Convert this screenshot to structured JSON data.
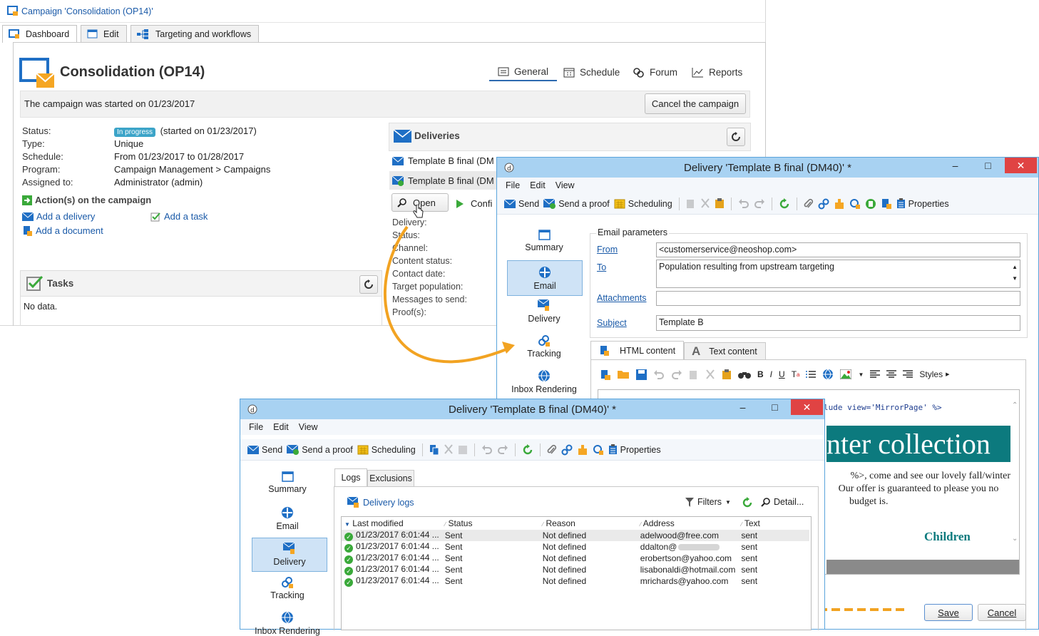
{
  "campaign": {
    "window_title": "Campaign 'Consolidation (OP14)'",
    "tabs": [
      {
        "label": "Dashboard"
      },
      {
        "label": "Edit"
      },
      {
        "label": "Targeting and workflows"
      }
    ],
    "heading": "Consolidation (OP14)",
    "nav": [
      {
        "label": "General"
      },
      {
        "label": "Schedule"
      },
      {
        "label": "Forum"
      },
      {
        "label": "Reports"
      }
    ],
    "started_message": "The campaign was started on 01/23/2017",
    "cancel_label": "Cancel the campaign",
    "info": {
      "status_label": "Status:",
      "status_badge": "In progress",
      "status_value": "(started on 01/23/2017)",
      "type_label": "Type:",
      "type_value": "Unique",
      "schedule_label": "Schedule:",
      "schedule_value": "From 01/23/2017 to 01/28/2017",
      "program_label": "Program:",
      "program_value": "Campaign Management > Campaigns",
      "assigned_label": "Assigned to:",
      "assigned_value": "Administrator (admin)"
    },
    "actions_title": "Action(s) on the campaign",
    "add_delivery": "Add a delivery",
    "add_task": "Add a task",
    "add_document": "Add a document",
    "tasks_title": "Tasks",
    "tasks_empty": "No data.",
    "deliveries": {
      "title": "Deliveries",
      "items": [
        "Template B final (DM",
        "Template B final (DM"
      ],
      "open_label": "Open",
      "confirm_label": "Confi",
      "fields": [
        "Delivery:",
        "Status:",
        "Channel:",
        "Content status:",
        "Contact date:",
        "Target population:",
        "Messages to send:",
        "Proof(s):"
      ]
    }
  },
  "delivery_back": {
    "title": "Delivery 'Template B final (DM40)' *",
    "menu": [
      "File",
      "Edit",
      "View"
    ],
    "toolbar": {
      "send": "Send",
      "proof": "Send a proof",
      "scheduling": "Scheduling",
      "properties": "Properties"
    },
    "side": [
      "Summary",
      "Email",
      "Delivery",
      "Tracking",
      "Inbox Rendering"
    ],
    "email_params": "Email parameters",
    "from_label": "From",
    "from_value": "<customerservice@neoshop.com>",
    "to_label": "To",
    "to_value": "Population resulting from upstream targeting",
    "attachments_label": "Attachments",
    "attachments_value": "",
    "subject_label": "Subject",
    "subject_value": "Template B",
    "content_tabs": [
      "HTML content",
      "Text content"
    ],
    "styles_label": "Styles",
    "editor": {
      "code": "lude view='MirrorPage' %>",
      "banner": "nter collection",
      "line1": "%>, come and see our lovely fall/winter",
      "line2": "Our offer is guaranteed to please you no",
      "line3": "budget is.",
      "children": "Children"
    },
    "save_label": "Save",
    "cancel_label": "Cancel"
  },
  "delivery_front": {
    "title": "Delivery 'Template B final (DM40)' *",
    "menu": [
      "File",
      "Edit",
      "View"
    ],
    "toolbar": {
      "send": "Send",
      "proof": "Send a proof",
      "scheduling": "Scheduling",
      "properties": "Properties"
    },
    "side": [
      "Summary",
      "Email",
      "Delivery",
      "Tracking",
      "Inbox Rendering"
    ],
    "tabs": [
      "Logs",
      "Exclusions"
    ],
    "logs_title": "Delivery logs",
    "filters_label": "Filters",
    "detail_label": "Detail...",
    "columns": [
      "Last modified",
      "Status",
      "Reason",
      "Address",
      "Text"
    ],
    "rows": [
      {
        "date": "01/23/2017 6:01:44 ...",
        "status": "Sent",
        "reason": "Not defined",
        "address": "adelwood@free.com",
        "text": "sent"
      },
      {
        "date": "01/23/2017 6:01:44 ...",
        "status": "Sent",
        "reason": "Not defined",
        "address": "ddalton@",
        "text": "sent"
      },
      {
        "date": "01/23/2017 6:01:44 ...",
        "status": "Sent",
        "reason": "Not defined",
        "address": "erobertson@yahoo.com",
        "text": "sent"
      },
      {
        "date": "01/23/2017 6:01:44 ...",
        "status": "Sent",
        "reason": "Not defined",
        "address": "lisabonaldi@hotmail.com",
        "text": "sent"
      },
      {
        "date": "01/23/2017 6:01:44 ...",
        "status": "Sent",
        "reason": "Not defined",
        "address": "mrichards@yahoo.com",
        "text": "sent"
      }
    ]
  },
  "colors": {
    "accent": "#1a5aa8",
    "titlebar": "#a8d2f2",
    "arrow": "#f2a322",
    "close": "#e04343"
  }
}
